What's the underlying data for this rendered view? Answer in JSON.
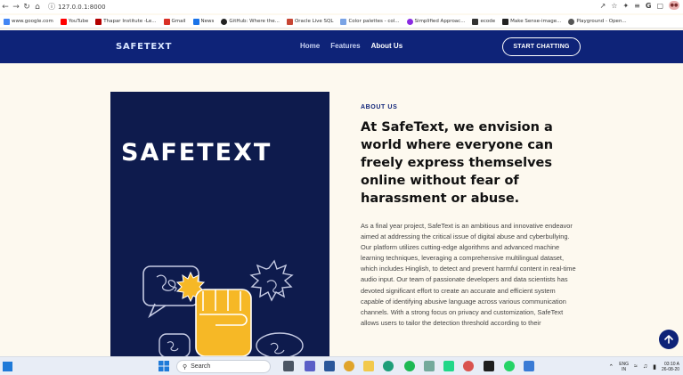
{
  "browser": {
    "url": "127.0.0.1:8000",
    "bookmarks": [
      {
        "label": "www.google.com",
        "color": "#4285f4"
      },
      {
        "label": "YouTube",
        "color": "#ff0000"
      },
      {
        "label": "Thapar Institute -Le...",
        "color": "#b30000"
      },
      {
        "label": "Gmail",
        "color": "#d93025"
      },
      {
        "label": "News",
        "color": "#1a73e8"
      },
      {
        "label": "GitHub: Where the...",
        "color": "#222222"
      },
      {
        "label": "Oracle Live SQL",
        "color": "#c74634"
      },
      {
        "label": "Color palettes - col...",
        "color": "#7aa3e5"
      },
      {
        "label": "Simplified Approac...",
        "color": "#8a2be2"
      },
      {
        "label": "ecode",
        "color": "#333333"
      },
      {
        "label": "Make Sense-image...",
        "color": "#222222"
      },
      {
        "label": "Playground - Open...",
        "color": "#555555"
      }
    ]
  },
  "site": {
    "logo": "SAFETEXT",
    "nav": {
      "home": "Home",
      "features": "Features",
      "about": "About Us"
    },
    "cta_label": "START CHATTING"
  },
  "about": {
    "image_logo": "SAFETEXT",
    "label": "ABOUT US",
    "title": "At SafeText, we envision a world where everyone can freely express themselves online without fear of harassment or abuse.",
    "body": "As a final year project, SafeText is an ambitious and innovative endeavor aimed at addressing the critical issue of digital abuse and cyberbullying. Our platform utilizes cutting-edge algorithms and advanced machine learning techniques, leveraging a comprehensive multilingual dataset, which includes Hinglish, to detect and prevent harmful content in real-time audio input. Our team of passionate developers and data scientists has devoted significant effort to create an accurate and efficient system capable of identifying abusive language across various communication channels. With a strong focus on privacy and customization, SafeText allows users to tailor the detection threshold according to their"
  },
  "taskbar": {
    "search_label": "Search",
    "lang_line1": "ENG",
    "lang_line2": "IN",
    "time": "03:10 A",
    "date": "26-08-20"
  },
  "colors": {
    "nav_bg": "#0e2378",
    "page_bg": "#fdf9ef",
    "image_bg": "#0e1b4d",
    "accent_yellow": "#f6b826"
  }
}
